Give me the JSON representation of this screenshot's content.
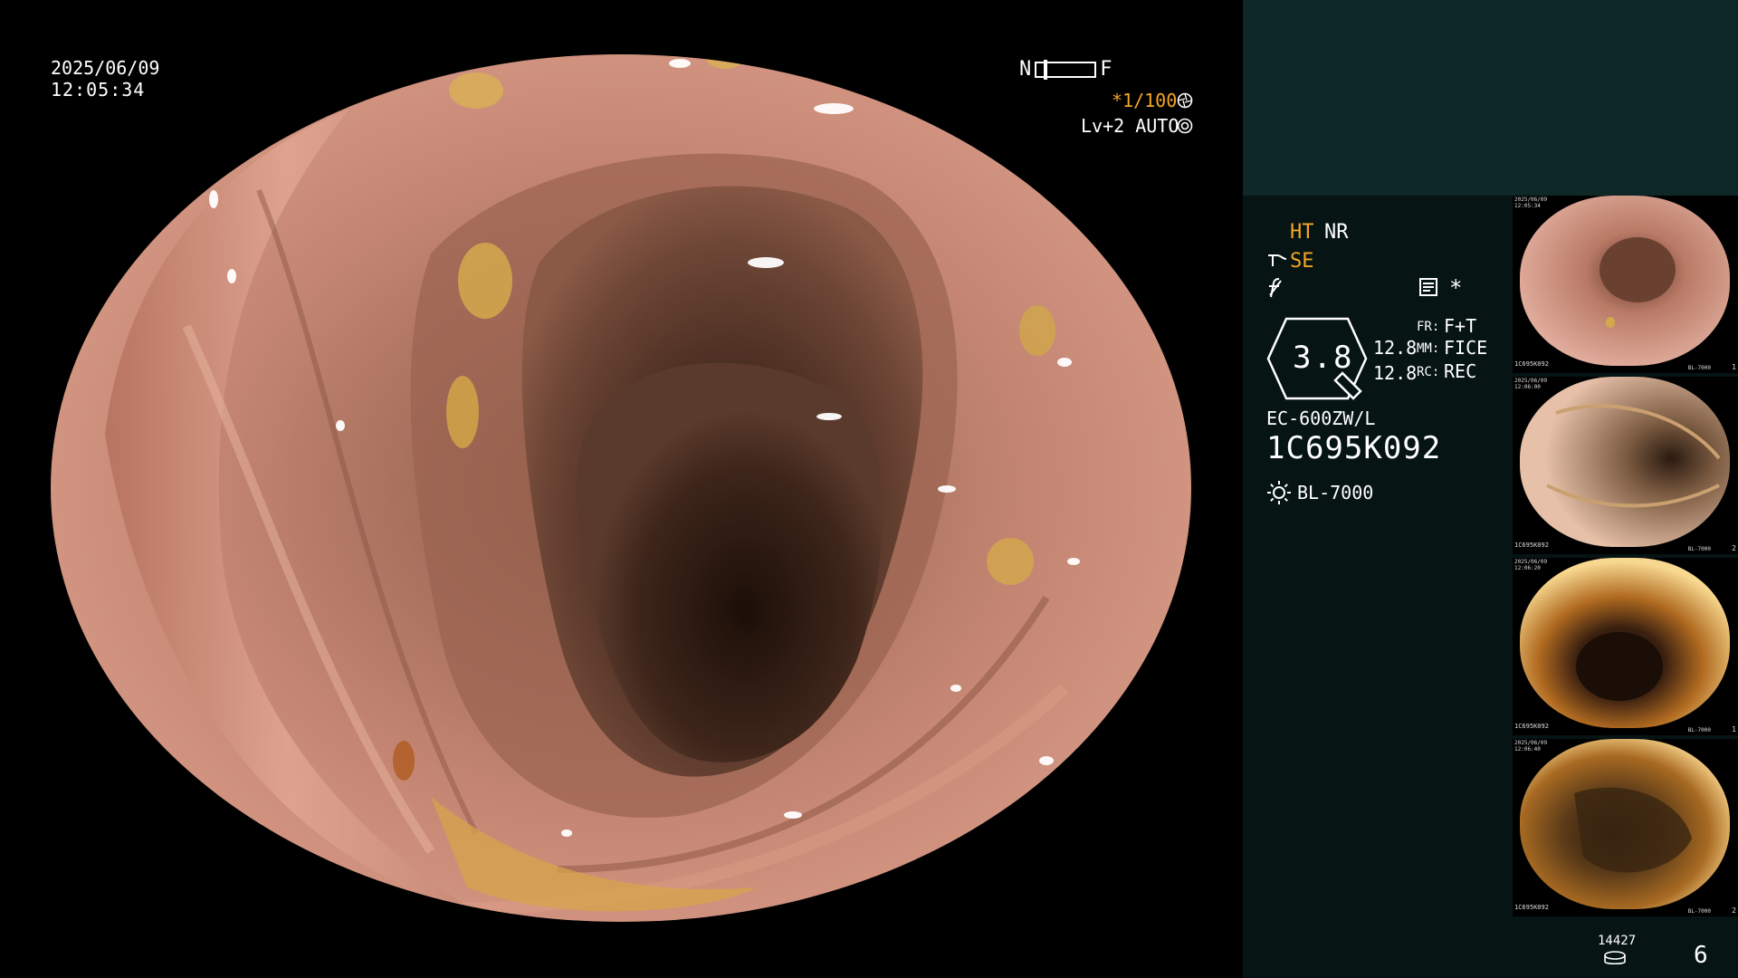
{
  "overlay": {
    "date": "2025/06/09",
    "time": "12:05:34",
    "nf_left": "N",
    "nf_right": "F",
    "shutter": "*1/100",
    "level": "Lv+2 AUTO"
  },
  "panel": {
    "ht": "HT",
    "nr": "NR",
    "se": "SE",
    "star": "*",
    "hex_value": "3.8",
    "val1": "12.8",
    "val2": "12.8",
    "fr_key": "FR:",
    "fr_val": "F+T",
    "mm_key": "MM:",
    "mm_val": "FICE",
    "rc_key": "RC:",
    "rc_val": "REC",
    "scope_model": "EC-600ZW/L",
    "serial": "1C695K092",
    "light_source": "BL-7000",
    "image_count": "14427",
    "page_number": "6"
  },
  "thumbnails": [
    {
      "date": "2025/06/09\n12:05:34",
      "serial": "1C695K092",
      "model": "BL-7000",
      "index": "1"
    },
    {
      "date": "2025/06/09\n12:06:00",
      "serial": "1C695K092",
      "model": "BL-7000",
      "index": "2"
    },
    {
      "date": "2025/06/09\n12:06:20",
      "serial": "1C695K092",
      "model": "BL-7000",
      "index": "1"
    },
    {
      "date": "2025/06/09\n12:06:40",
      "serial": "1C695K092",
      "model": "BL-7000",
      "index": "2"
    }
  ],
  "colors": {
    "accent_orange": "#f5a623",
    "panel_bg": "#071414",
    "panel_top_bg": "#0e2727",
    "mucosa": "#c98872"
  },
  "icons": [
    "scope-tool-icon",
    "fice-icon",
    "memo-icon",
    "shutter-icon",
    "auto-icon",
    "light-source-icon",
    "disk-icon"
  ]
}
